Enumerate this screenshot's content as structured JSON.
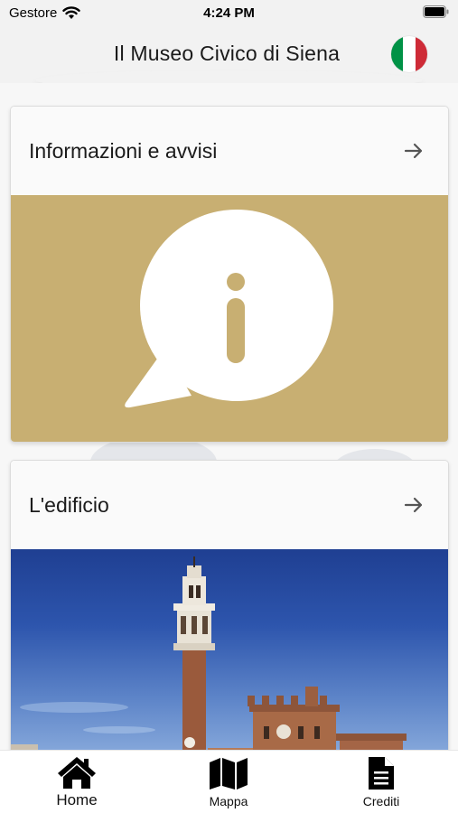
{
  "status_bar": {
    "carrier": "Gestore",
    "time": "4:24 PM"
  },
  "header": {
    "title": "Il Museo Civico di Siena",
    "language_flag": "italian-flag-icon"
  },
  "colors": {
    "card_media": "#c8af72",
    "flag_green": "#009246",
    "flag_white": "#ffffff",
    "flag_red": "#ce2b37"
  },
  "cards": [
    {
      "title": "Informazioni e avvisi",
      "icon": "info-speech-bubble-icon",
      "action_icon": "arrow-right-icon"
    },
    {
      "title": "L'edificio",
      "image": "palazzo-pubblico-siena-photo",
      "action_icon": "arrow-right-icon"
    }
  ],
  "tabs": [
    {
      "label": "Home",
      "icon": "home-icon",
      "selected": true
    },
    {
      "label": "Mappa",
      "icon": "map-icon",
      "selected": false
    },
    {
      "label": "Crediti",
      "icon": "document-icon",
      "selected": false
    }
  ]
}
